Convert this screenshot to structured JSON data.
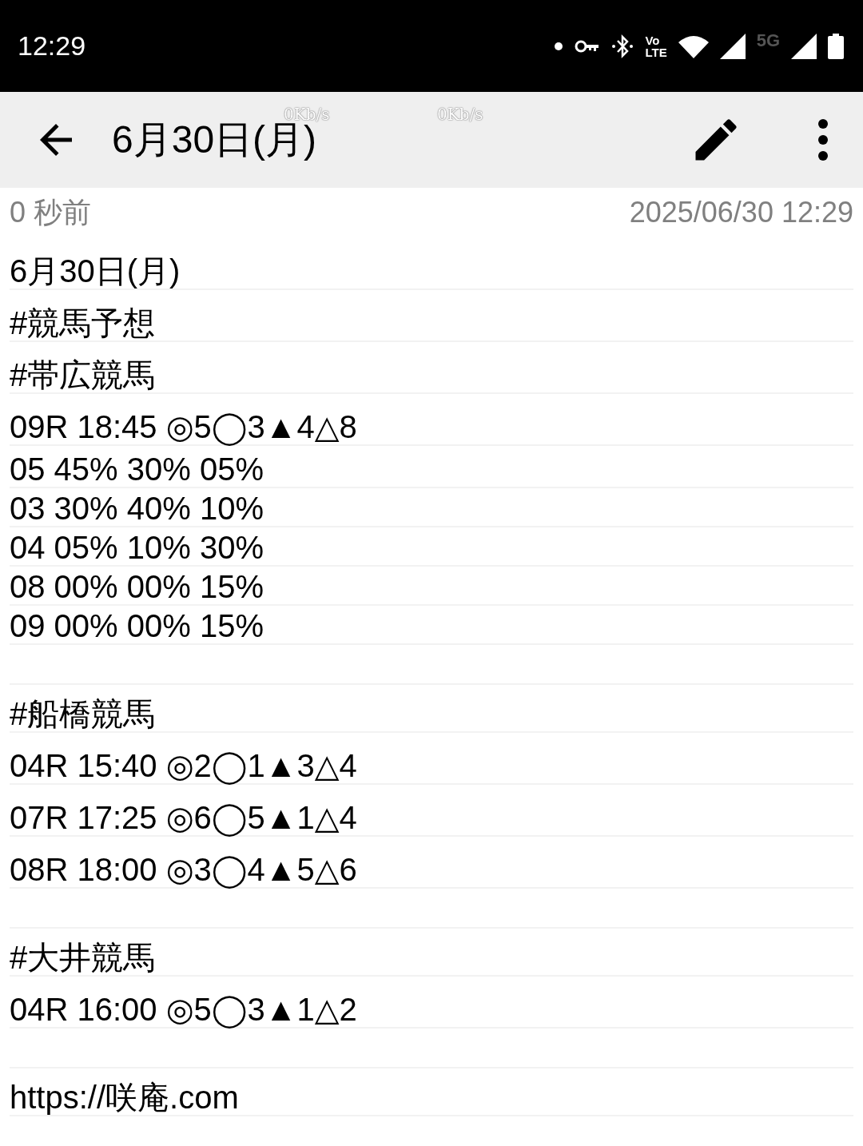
{
  "status_bar": {
    "time": "12:29",
    "volte": [
      "Vo",
      "LTE"
    ],
    "network_label": "5G"
  },
  "network_speed_overlays": [
    "0Kb/s",
    "0Kb/s"
  ],
  "app_bar": {
    "title": "6月30日(月)"
  },
  "meta": {
    "relative_time": "0 秒前",
    "timestamp": "2025/06/30 12:29"
  },
  "lines": [
    {
      "kind": "text",
      "text": "6月30日(月)"
    },
    {
      "kind": "text",
      "text": "#競馬予想"
    },
    {
      "kind": "text",
      "text": "#帯広競馬"
    },
    {
      "kind": "text",
      "text": "09R 18:45 ◎5◯3▲4△8"
    },
    {
      "kind": "odds",
      "text": "05 45% 30% 05%"
    },
    {
      "kind": "odds",
      "text": "03 30% 40% 10%"
    },
    {
      "kind": "odds",
      "text": "04 05% 10% 30%"
    },
    {
      "kind": "odds",
      "text": "08 00% 00% 15%"
    },
    {
      "kind": "odds",
      "text": "09 00% 00% 15%"
    },
    {
      "kind": "blank"
    },
    {
      "kind": "text",
      "text": "#船橋競馬"
    },
    {
      "kind": "text",
      "text": "04R 15:40 ◎2◯1▲3△4"
    },
    {
      "kind": "text",
      "text": "07R 17:25 ◎6◯5▲1△4"
    },
    {
      "kind": "text",
      "text": "08R 18:00 ◎3◯4▲5△6"
    },
    {
      "kind": "blank"
    },
    {
      "kind": "text",
      "text": "#大井競馬"
    },
    {
      "kind": "text",
      "text": "04R 16:00 ◎5◯3▲1△2"
    },
    {
      "kind": "blank"
    },
    {
      "kind": "text",
      "text": "https://咲庵.com"
    }
  ]
}
